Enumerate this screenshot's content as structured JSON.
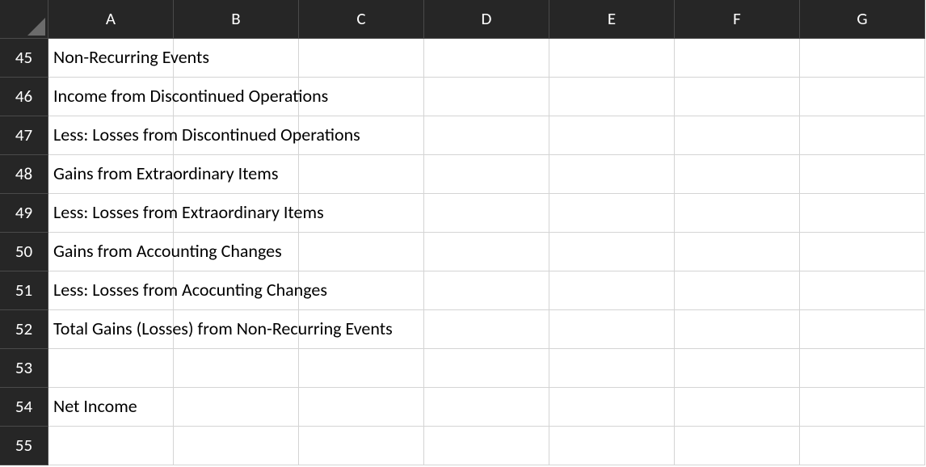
{
  "columns": [
    "A",
    "B",
    "C",
    "D",
    "E",
    "F",
    "G"
  ],
  "rowStart": 45,
  "rowEnd": 55,
  "rows": [
    {
      "num": 45,
      "a": "Non-Recurring Events"
    },
    {
      "num": 46,
      "a": "Income from Discontinued Operations"
    },
    {
      "num": 47,
      "a": "Less: Losses from Discontinued Operations"
    },
    {
      "num": 48,
      "a": "Gains from Extraordinary Items"
    },
    {
      "num": 49,
      "a": "Less: Losses from Extraordinary Items"
    },
    {
      "num": 50,
      "a": "Gains from Accounting Changes"
    },
    {
      "num": 51,
      "a": "Less: Losses from Acocunting Changes"
    },
    {
      "num": 52,
      "a": "Total Gains (Losses) from Non-Recurring Events"
    },
    {
      "num": 53,
      "a": ""
    },
    {
      "num": 54,
      "a": "Net Income"
    },
    {
      "num": 55,
      "a": ""
    }
  ]
}
